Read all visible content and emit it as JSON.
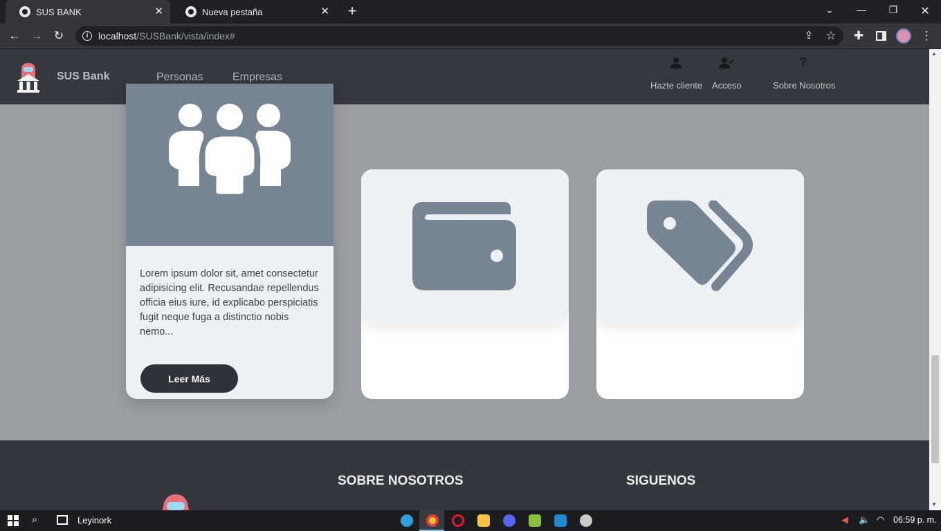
{
  "browser": {
    "tabs": [
      {
        "title": "SUS BANK",
        "active": true
      },
      {
        "title": "Nueva pestaña",
        "active": false
      }
    ],
    "new_tab_glyph": "+",
    "url_host": "localhost",
    "url_path": "/SUSBank/vista/index#"
  },
  "navbar": {
    "brand": "SUS Bank",
    "links": [
      "Personas",
      "Empresas"
    ],
    "actions": [
      {
        "label": "Hazte cliente",
        "icon": "user-icon"
      },
      {
        "label": "Acceso",
        "icon": "user-check-icon"
      },
      {
        "label": "Sobre Nosotros",
        "icon": "question-icon"
      }
    ]
  },
  "cards": [
    {
      "icon": "users-icon",
      "text": "Lorem ipsum dolor sit, amet consectetur adipisicing elit. Recusandae repellendus officia eius iure, id explicabo perspiciatis fugit neque fuga a distinctio nobis nemo...",
      "button": "Leer Más"
    },
    {
      "icon": "wallet-icon"
    },
    {
      "icon": "tags-icon"
    }
  ],
  "footer": {
    "sections": [
      "SOBRE NOSOTROS",
      "SIGUENOS"
    ]
  },
  "taskbar": {
    "user": "Leyinork",
    "time": "06:59 p. m."
  },
  "colors": {
    "page_bg": "#9a9ea2",
    "navbar_bg": "#35383e",
    "card_icon": "#778592",
    "button_bg": "#2f3238"
  }
}
